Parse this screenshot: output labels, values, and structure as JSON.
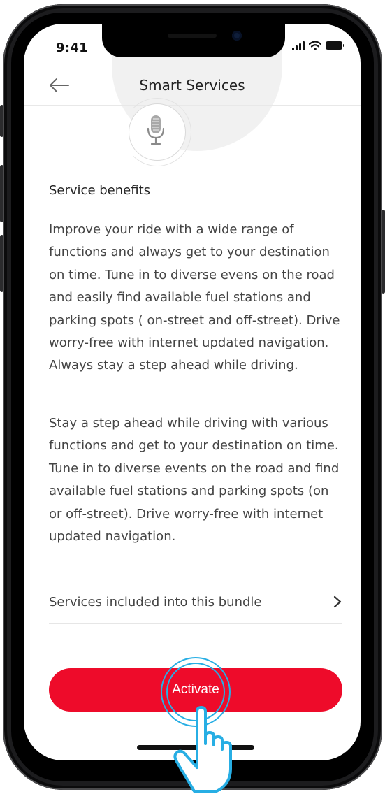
{
  "status_bar": {
    "time": "9:41"
  },
  "header": {
    "title": "Smart Services",
    "back_icon": "arrow-left-icon"
  },
  "hero": {
    "icon": "microphone-icon"
  },
  "content": {
    "section_title": "Service benefits",
    "paragraph1": "Improve your ride with a wide range of functions and always get to your destination on time. Tune in to diverse evens on the road and easily find available fuel stations and parking spots ( on-street and off-street). Drive worry-free with internet updated navigation. Always stay a step ahead while driving.",
    "paragraph2": "Stay a step ahead while driving with various functions and get to your destination on time. Tune in to diverse events on the road and find available fuel stations and parking spots (on or off-street). Drive worry-free with internet updated navigation."
  },
  "bundle_row": {
    "label": "Services included into this bundle",
    "icon": "chevron-right-icon"
  },
  "activate_button": {
    "label": "Activate"
  },
  "colors": {
    "accent": "#ee0b2a",
    "tap_highlight": "#27aee4"
  }
}
